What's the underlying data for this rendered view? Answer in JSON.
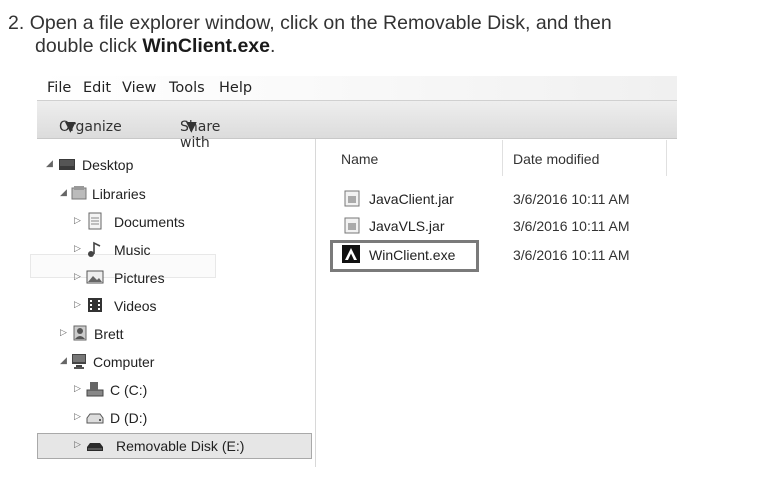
{
  "instruction": {
    "number": "2.",
    "text_before": "Open a file explorer window, click on the Removable Disk, and then",
    "text_line2_before": "double click ",
    "bold": "WinClient.exe",
    "text_after": "."
  },
  "menu": [
    "File",
    "Edit",
    "View",
    "Tools",
    "Help"
  ],
  "toolbar": {
    "organize": "Organize",
    "share": "Share with"
  },
  "nav": {
    "desktop": "Desktop",
    "libraries": "Libraries",
    "documents": "Documents",
    "music": "Music",
    "pictures": "Pictures",
    "videos": "Videos",
    "brett": "Brett",
    "computer": "Computer",
    "c_drive": "C (C:)",
    "d_drive": "D (D:)",
    "removable": "Removable Disk (E:)"
  },
  "columns": {
    "name": "Name",
    "date": "Date modified"
  },
  "files": [
    {
      "name": "JavaClient.jar",
      "date": "3/6/2016 10:11 AM",
      "icon": "jar-file-icon"
    },
    {
      "name": "JavaVLS.jar",
      "date": "3/6/2016 10:11 AM",
      "icon": "jar-file-icon"
    },
    {
      "name": "WinClient.exe",
      "date": "3/6/2016 10:11 AM",
      "icon": "app-exe-icon"
    }
  ]
}
